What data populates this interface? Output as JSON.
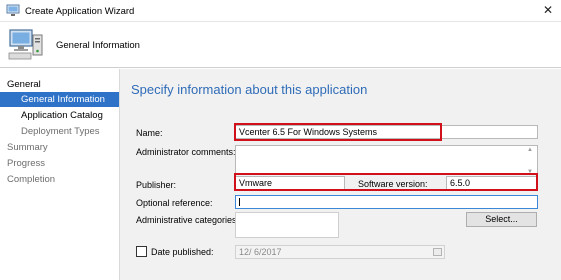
{
  "window": {
    "title": "Create Application Wizard",
    "close_glyph": "✕"
  },
  "header": {
    "title": "General Information",
    "icon": "computer-setup-icon"
  },
  "nav": {
    "items": [
      {
        "label": "General"
      },
      {
        "label": "General Information"
      },
      {
        "label": "Application Catalog"
      },
      {
        "label": "Deployment Types"
      },
      {
        "label": "Summary"
      },
      {
        "label": "Progress"
      },
      {
        "label": "Completion"
      }
    ]
  },
  "content": {
    "heading": "Specify information about this application",
    "name": {
      "label": "Name:",
      "value": "Vcenter 6.5 For Windows Systems"
    },
    "admin_comments": {
      "label": "Administrator comments:",
      "value": ""
    },
    "publisher": {
      "label": "Publisher:",
      "value": "Vmware"
    },
    "software_version": {
      "label": "Software version:",
      "value": "6.5.0"
    },
    "optional_reference": {
      "label": "Optional reference:",
      "value": ""
    },
    "admin_categories": {
      "label": "Administrative categories:",
      "value": "",
      "button": "Select..."
    },
    "date_published": {
      "label": "Date published:",
      "value": "12/  6/2017",
      "checked": false
    }
  },
  "colors": {
    "accent": "#2f73c9",
    "heading": "#2f6cb8",
    "highlight_box": "#d0101b"
  }
}
